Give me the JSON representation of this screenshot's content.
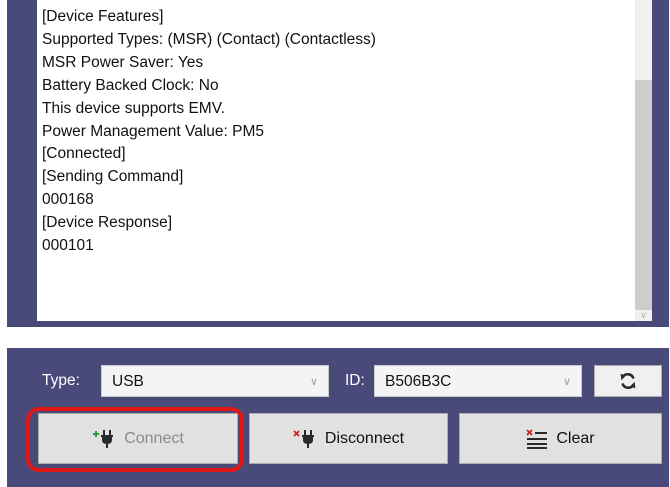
{
  "log": {
    "lines": [
      "[Device Features]",
      "Supported Types: (MSR) (Contact) (Contactless)",
      "MSR Power Saver: Yes",
      "Battery Backed Clock: No",
      "This device supports EMV.",
      "Power Management Value: PM5",
      "[Connected]",
      "[Sending Command]",
      "000168",
      "[Device Response]",
      "000101"
    ]
  },
  "toolbar": {
    "type_label": "Type:",
    "type_value": "USB",
    "id_label": "ID:",
    "id_value": "B506B3C",
    "refresh_icon": "refresh-icon",
    "connect_label": "Connect",
    "connect_icon": "plug-add-icon",
    "disconnect_label": "Disconnect",
    "disconnect_icon": "plug-remove-icon",
    "clear_label": "Clear",
    "clear_icon": "clear-list-icon"
  },
  "colors": {
    "panel_bg": "#4a4a7a",
    "highlight": "#e01818",
    "plug_add": "#2e9c3a",
    "plug_remove": "#d02020"
  }
}
